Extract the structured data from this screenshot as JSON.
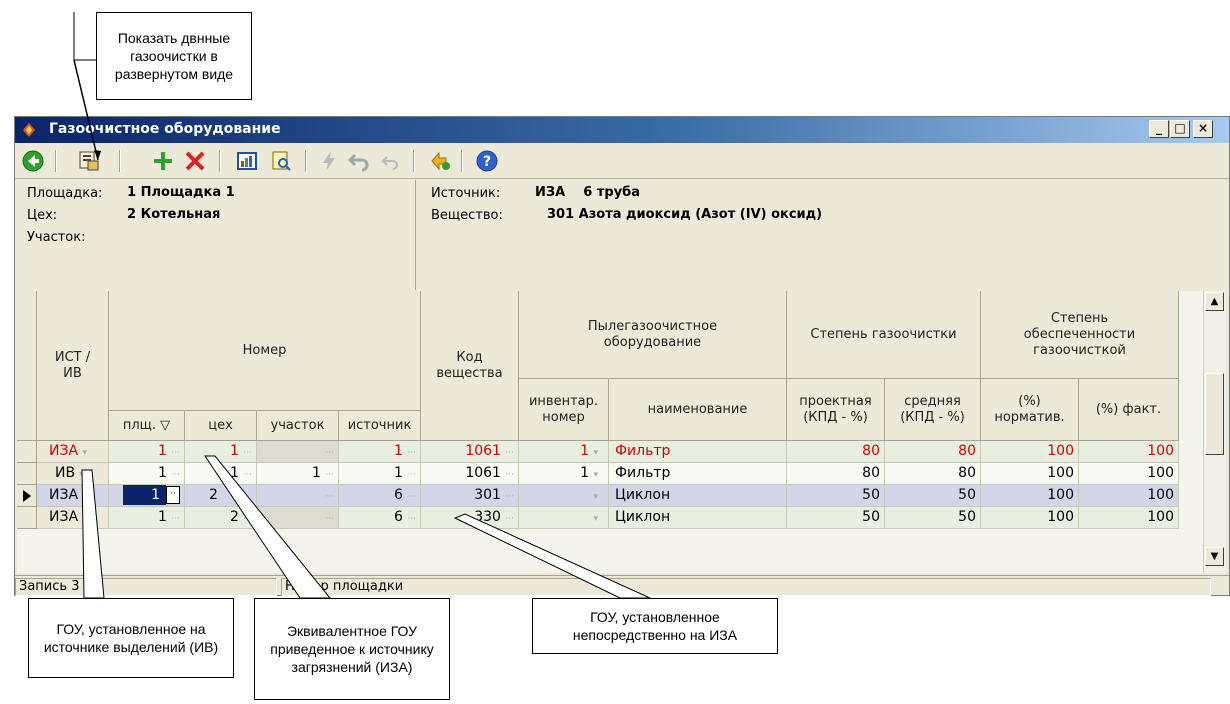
{
  "callouts": {
    "top": "Показать двнные газоочистки в развернутом виде",
    "gou_iv": "ГОУ, установленное на источнике выделений (ИВ)",
    "equiv": "Эквивалентное ГОУ приведенное  к источнику загрязнений (ИЗА)",
    "gou_iza": "ГОУ, установленное непосредственно на ИЗА"
  },
  "window": {
    "title": "Газоочистное оборудование",
    "buttons": {
      "minimize": "_",
      "maximize": "□",
      "close": "×"
    }
  },
  "toolbar": {
    "icons": [
      "back-icon",
      "expand-details-icon",
      "add-icon",
      "delete-icon",
      "report-icon",
      "search-doc-icon",
      "lightning-icon",
      "undo-icon",
      "redo-icon",
      "refresh-icon",
      "help-icon"
    ]
  },
  "info": {
    "site_label": "Площадка:",
    "site_value": "1 Площадка 1",
    "shop_label": "Цех:",
    "shop_value": "2 Котельная",
    "section_label": "Участок:",
    "section_value": "",
    "source_label": "Источник:",
    "source_value": "ИЗА    6 труба",
    "substance_label": "Вещество:",
    "substance_value": "301 Азота диоксид (Азот (IV) оксид)"
  },
  "grid": {
    "headers": {
      "ist": "ИСТ /ИВ",
      "nomer": "Номер",
      "plsh": "плщ. ▽",
      "tseh": "цех",
      "uchastok": "участок",
      "istochnik": "источник",
      "kod": "Код вещества",
      "pgo": "Пылегазоочистное оборудование",
      "inv": "инвентар. номер",
      "naim": "наименование",
      "stepen": "Степень газоочистки",
      "proekt": "проектная (КПД - %)",
      "sred": "средняя (КПД - %)",
      "obesp": "Степень обеспеченности газоочисткой",
      "normativ": "(%) норматив.",
      "fakt": "(%) факт."
    },
    "rows": [
      {
        "ist": "ИЗА",
        "plsh": "1",
        "tseh": "1",
        "uchastok": "",
        "istochnik": "1",
        "kod": "1061",
        "inv": "1",
        "naim": "Фильтр",
        "proekt": "80",
        "sred": "80",
        "normativ": "100",
        "fakt": "100",
        "red": true
      },
      {
        "ist": "ИВ",
        "plsh": "1",
        "tseh": "1",
        "uchastok": "1",
        "istochnik": "1",
        "kod": "1061",
        "inv": "1",
        "naim": "Фильтр",
        "proekt": "80",
        "sred": "80",
        "normativ": "100",
        "fakt": "100",
        "red": false
      },
      {
        "ist": "ИЗА",
        "plsh": "1",
        "tseh": "2",
        "uchastok": "",
        "istochnik": "6",
        "kod": "301",
        "inv": "",
        "naim": "Циклон",
        "proekt": "50",
        "sred": "50",
        "normativ": "100",
        "fakt": "100",
        "red": false
      },
      {
        "ist": "ИЗА",
        "plsh": "1",
        "tseh": "2",
        "uchastok": "",
        "istochnik": "6",
        "kod": "330",
        "inv": "",
        "naim": "Циклон",
        "proekt": "50",
        "sred": "50",
        "normativ": "100",
        "fakt": "100",
        "red": false
      }
    ]
  },
  "status": {
    "record": "Запись 3 и",
    "hint": "Номер площадки"
  }
}
